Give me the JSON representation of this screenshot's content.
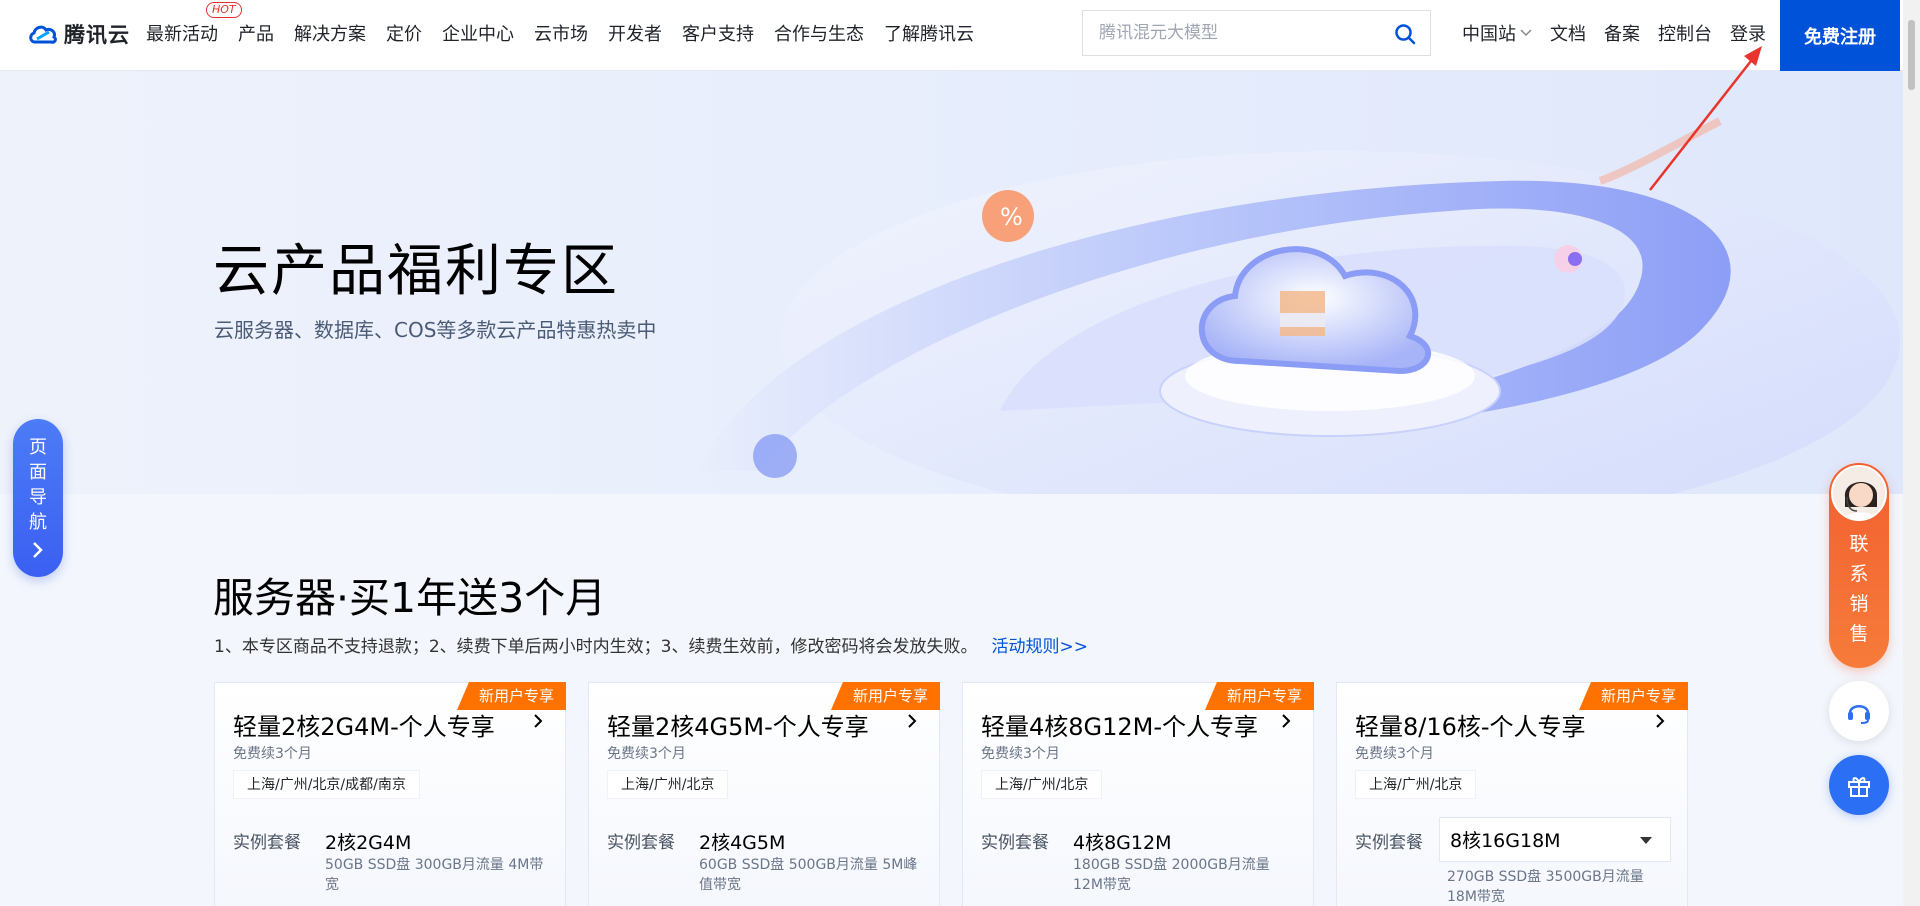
{
  "brand": {
    "name": "腾讯云"
  },
  "nav": {
    "menu": [
      {
        "label": "最新活动",
        "badge": "HOT"
      },
      {
        "label": "产品"
      },
      {
        "label": "解决方案"
      },
      {
        "label": "定价"
      },
      {
        "label": "企业中心"
      },
      {
        "label": "云市场"
      },
      {
        "label": "开发者"
      },
      {
        "label": "客户支持"
      },
      {
        "label": "合作与生态"
      },
      {
        "label": "了解腾讯云"
      }
    ],
    "search_placeholder": "腾讯混元大模型",
    "region": "中国站",
    "docs": "文档",
    "filing": "备案",
    "console": "控制台",
    "login": "登录",
    "register": "免费注册"
  },
  "banner": {
    "title": "云产品福利专区",
    "subtitle": "云服务器、数据库、COS等多款云产品特惠热卖中"
  },
  "page_nav": {
    "label": "页面导航"
  },
  "contact": {
    "label": "联系销售"
  },
  "section": {
    "title": "服务器·买1年送3个月",
    "notes": "1、本专区商品不支持退款；2、续费下单后两小时内生效；3、续费生效前，修改密码将会发放失败。",
    "rules_link": "活动规则>>"
  },
  "cards": [
    {
      "badge": "新用户专享",
      "title": "轻量2核2G4M-个人专享",
      "free": "免费续3个月",
      "region": "上海/广州/北京/成都/南京",
      "spec_label": "实例套餐",
      "spec": "2核2G4M",
      "desc": "50GB SSD盘 300GB月流量 4M带宽"
    },
    {
      "badge": "新用户专享",
      "title": "轻量2核4G5M-个人专享",
      "free": "免费续3个月",
      "region": "上海/广州/北京",
      "spec_label": "实例套餐",
      "spec": "2核4G5M",
      "desc": "60GB SSD盘 500GB月流量 5M峰值带宽"
    },
    {
      "badge": "新用户专享",
      "title": "轻量4核8G12M-个人专享",
      "free": "免费续3个月",
      "region": "上海/广州/北京",
      "spec_label": "实例套餐",
      "spec": "4核8G12M",
      "desc": "180GB SSD盘 2000GB月流量 12M带宽"
    },
    {
      "badge": "新用户专享",
      "title": "轻量8/16核-个人专享",
      "free": "免费续3个月",
      "region": "上海/广州/北京",
      "spec_label": "实例套餐",
      "spec": "8核16G18M",
      "desc": "270GB SSD盘 3500GB月流量 18M带宽"
    }
  ],
  "colors": {
    "brand_blue": "#0052d9",
    "badge_orange": "#ff7200",
    "hot_red": "#e6312f"
  }
}
